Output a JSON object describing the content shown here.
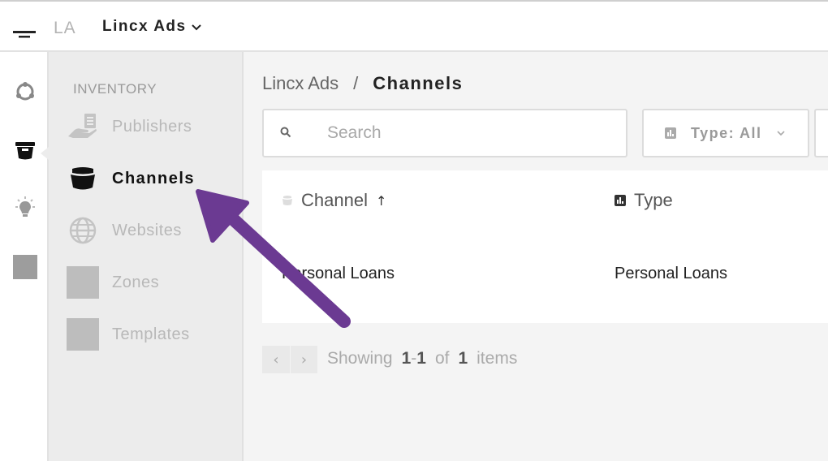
{
  "header": {
    "brand_abbr": "LA",
    "account_name": "Lincx Ads"
  },
  "rail": {
    "items": [
      {
        "icon": "rings-icon"
      },
      {
        "icon": "bucket-icon"
      },
      {
        "icon": "lightbulb-icon"
      },
      {
        "icon": "grey-square-icon"
      }
    ]
  },
  "subnav": {
    "heading": "INVENTORY",
    "items": [
      {
        "label": "Publishers",
        "icon": "publisher-hand-icon"
      },
      {
        "label": "Channels",
        "icon": "bucket-icon",
        "active": true
      },
      {
        "label": "Websites",
        "icon": "globe-icon"
      },
      {
        "label": "Zones",
        "icon": "grey-square-icon"
      },
      {
        "label": "Templates",
        "icon": "grey-square-icon"
      }
    ]
  },
  "main": {
    "breadcrumb": {
      "parent": "Lincx Ads",
      "separator": "/",
      "current": "Channels"
    },
    "search": {
      "placeholder": "Search",
      "value": ""
    },
    "filter": {
      "label": "Type: All"
    },
    "table": {
      "headers": [
        {
          "label": "Channel",
          "sort": "↑"
        },
        {
          "label": "Type"
        }
      ],
      "rows": [
        [
          "Personal Loans",
          "Personal Loans"
        ]
      ]
    },
    "pagination": {
      "prev": "‹",
      "next": "›",
      "showing_label": "Showing",
      "from": "1",
      "dash": "-",
      "to": "1",
      "of_label": "of",
      "total": "1",
      "items_label": "items"
    }
  },
  "colors": {
    "annotation_arrow": "#6b3a92",
    "active_text": "#111111",
    "muted_text": "#b8b8b8"
  }
}
